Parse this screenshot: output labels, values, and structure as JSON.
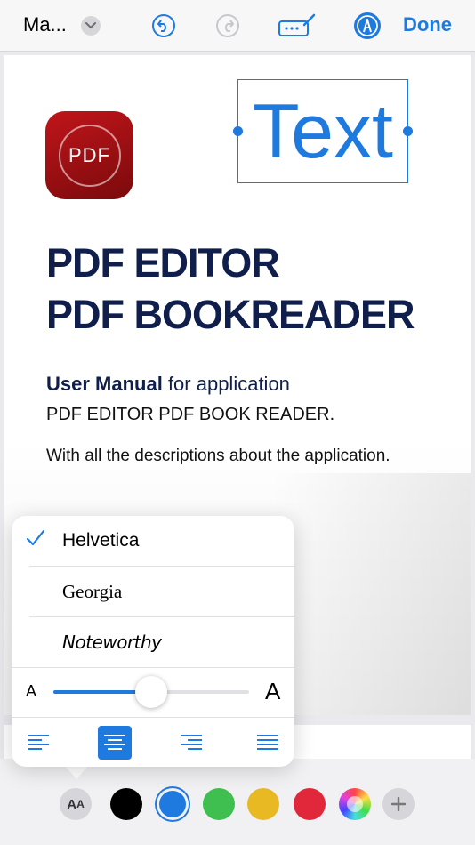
{
  "toolbar": {
    "doc_title": "Ma...",
    "done_label": "Done"
  },
  "page": {
    "app_icon_label": "PDF",
    "text_annotation": "Text",
    "title_line1": "PDF EDITOR",
    "title_line2": "PDF BOOKREADER",
    "manual_bold": "User Manual",
    "manual_rest": " for application",
    "subtitle": "PDF EDITOR PDF BOOK READER.",
    "description": "With all the descriptions about the application."
  },
  "font_popover": {
    "fonts": [
      {
        "name": "Helvetica",
        "selected": true
      },
      {
        "name": "Georgia",
        "selected": false
      },
      {
        "name": "Noteworthy",
        "selected": false
      }
    ],
    "size_small_label": "A",
    "size_large_label": "A",
    "size_level": 0.5,
    "alignments": [
      "left",
      "center",
      "right",
      "justify"
    ],
    "selected_alignment": "center"
  },
  "bottom_tools": {
    "aa_label_big": "A",
    "aa_label_small": "A",
    "colors": [
      {
        "name": "black",
        "hex": "#000000",
        "selected": false
      },
      {
        "name": "blue",
        "hex": "#1f7ae0",
        "selected": true
      },
      {
        "name": "green",
        "hex": "#3fbf4f",
        "selected": false
      },
      {
        "name": "yellow",
        "hex": "#e8b923",
        "selected": false
      },
      {
        "name": "red",
        "hex": "#e0283a",
        "selected": false
      }
    ],
    "color_picker_icon": "color-wheel-icon",
    "add_icon": "plus-icon"
  },
  "colors": {
    "accent": "#1f7ae0",
    "navy": "#0f1e4a",
    "icon_red": "#b01116"
  }
}
